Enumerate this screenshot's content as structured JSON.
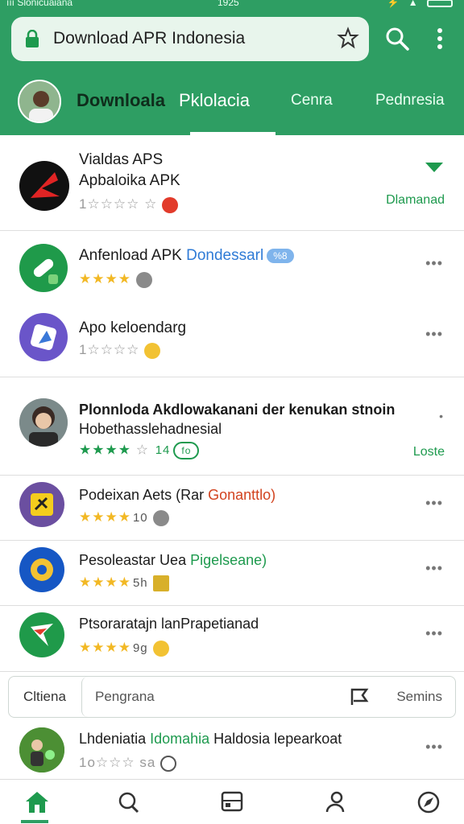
{
  "status": {
    "left": "ııı Slonicuaiana",
    "center": "1925",
    "right": "⚡ ▲"
  },
  "search": {
    "query": "Download APR Indonesia"
  },
  "tabs": [
    {
      "label": "Downloala"
    },
    {
      "label": "Pklolacia"
    },
    {
      "label": "Cenra"
    },
    {
      "label": "Pednresia"
    }
  ],
  "apps": [
    {
      "line1": "Vialdas APS",
      "line2": "Apbaloika APK",
      "rating_text": "1☆☆☆☆ ☆",
      "action": "Dlamanad",
      "stars_on": 0
    },
    {
      "title_a": "Anfenload APK",
      "title_b": "Dondessarl",
      "badge": "%8",
      "stars_on": 4
    },
    {
      "title": "Apo keloendarg",
      "rating_text": "1☆☆☆☆",
      "stars_on": 0
    },
    {
      "line1": "Plonnloda Akdlowakanani der kenukan stnoin",
      "line2": "Hobethasslehadnesial",
      "count": "14",
      "badge": "fo",
      "action": "Loste",
      "stars_on": 4
    },
    {
      "title_a": "Podeixan Aets (Rar ",
      "title_b": "Gonanttlo)",
      "count": "10",
      "stars_on": 4
    },
    {
      "title_a": "Pesoleastar Uea ",
      "title_b": "Pigelseane)",
      "count": "5h",
      "stars_on": 4
    },
    {
      "title": "Ptsoraratajn lanPrapetianad",
      "count": "9g",
      "stars_on": 4
    },
    {
      "title_a": "Lhdeniatia ",
      "title_b": "Idomahia",
      "title_c": " Haldosia lepearkoat",
      "rating_text": "1o☆☆☆ sa",
      "stars_on": 0
    }
  ],
  "inline_search": {
    "prefix": "Cltiena",
    "placeholder": "Pengrana",
    "suffix": "Semins"
  },
  "bottom_nav": [
    {
      "icon": "home-icon"
    },
    {
      "icon": "search-icon"
    },
    {
      "icon": "apps-icon"
    },
    {
      "icon": "people-icon"
    },
    {
      "icon": "compass-icon"
    }
  ],
  "colors": {
    "brand": "#2e9e63",
    "star": "#f2b824",
    "link": "#1e9a4e"
  }
}
